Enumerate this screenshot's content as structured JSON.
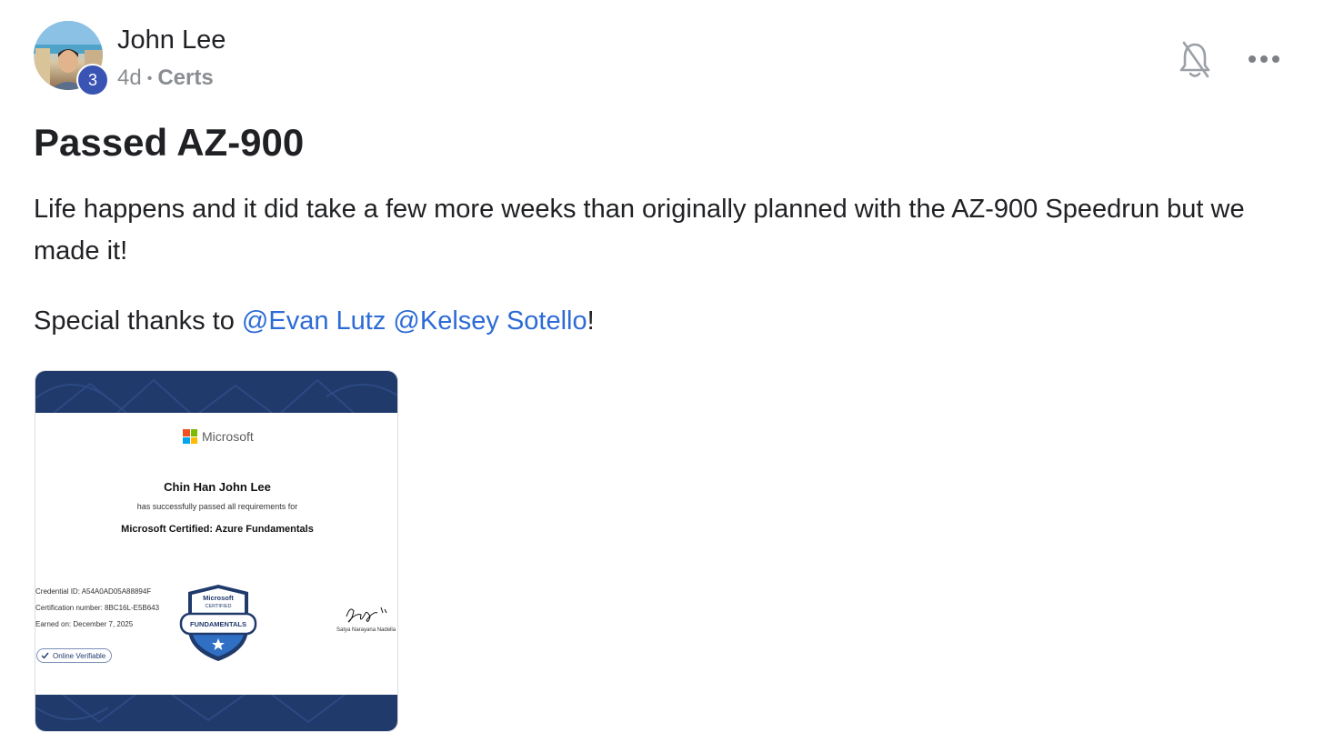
{
  "post": {
    "author": "John Lee",
    "level": "3",
    "age": "4d",
    "separator": "•",
    "category": "Certs",
    "title": "Passed AZ-900",
    "body": "Life happens and it did take a few more weeks than originally planned with the AZ-900 Speedrun but we made it!",
    "thanks_prefix": "Special thanks to ",
    "mentions": [
      "@Evan Lutz",
      "@Kelsey Sotello"
    ],
    "thanks_suffix": "!"
  },
  "icons": {
    "notifications": "bell-off-icon",
    "more": "more-horizontal-icon"
  },
  "colors": {
    "mention": "#2d6bd6",
    "level_badge": "#3a54b4",
    "cert_band": "#203a6c"
  },
  "certificate": {
    "brand": "Microsoft",
    "recipient": "Chin Han John Lee",
    "statement": "has successfully passed all requirements for",
    "certification": "Microsoft Certified: Azure Fundamentals",
    "credential_id": "Credential ID: A54A0AD05A88894F",
    "cert_number": "Certification number: 8BC16L-E5B643",
    "earned": "Earned on: December 7, 2025",
    "verifiable": "Online Verifiable",
    "badge_top_1": "Microsoft",
    "badge_top_2": "CERTIFIED",
    "badge_label": "FUNDAMENTALS",
    "signer": "Satya Narayana Nadella"
  }
}
